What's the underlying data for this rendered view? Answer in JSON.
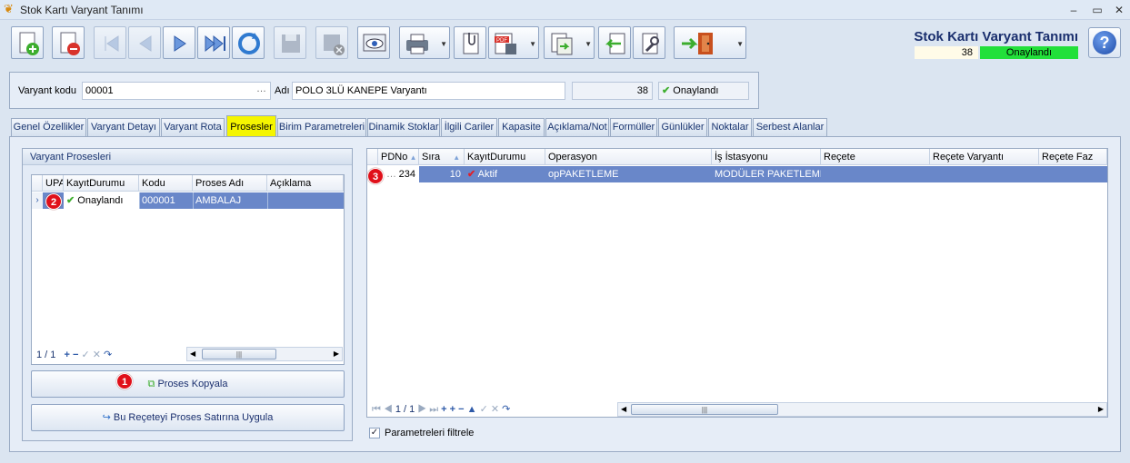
{
  "window": {
    "title": "Stok Kartı Varyant Tanımı",
    "minimize": "–",
    "restore": "▭",
    "close": "✕"
  },
  "header": {
    "title": "Stok Kartı Varyant Tanımı",
    "number": "38",
    "status": "Onaylandı",
    "status_color": "#22e03a"
  },
  "toolbar": {
    "buttons": [
      {
        "icon": "new-document-icon",
        "enabled": true
      },
      {
        "icon": "delete-document-icon",
        "enabled": true
      },
      {
        "icon": "first-record-icon",
        "enabled": false
      },
      {
        "icon": "previous-record-icon",
        "enabled": false
      },
      {
        "icon": "next-record-icon",
        "enabled": true
      },
      {
        "icon": "last-record-icon",
        "enabled": true
      },
      {
        "icon": "refresh-icon",
        "enabled": true
      },
      {
        "icon": "save-icon",
        "enabled": false
      },
      {
        "icon": "cancel-save-icon",
        "enabled": false
      },
      {
        "icon": "preview-icon",
        "enabled": true
      },
      {
        "icon": "print-icon",
        "enabled": true
      },
      {
        "icon": "attachment-icon",
        "enabled": true
      },
      {
        "icon": "pdf-export-icon",
        "enabled": true
      },
      {
        "icon": "export-icon",
        "enabled": true
      },
      {
        "icon": "import-icon",
        "enabled": true
      },
      {
        "icon": "settings-tool-icon",
        "enabled": true
      },
      {
        "icon": "exit-door-icon",
        "enabled": true
      }
    ]
  },
  "form": {
    "variant_code_label": "Varyant kodu",
    "variant_code": "00001",
    "name_label": "Adı",
    "name_value": "POLO 3LÜ KANEPE Varyantı",
    "number": "38",
    "status": "Onaylandı"
  },
  "tabs": [
    {
      "label": "Genel Özellikler"
    },
    {
      "label": "Varyant Detayı"
    },
    {
      "label": "Varyant Rota"
    },
    {
      "label": "Prosesler",
      "active": true
    },
    {
      "label": "Birim Parametreleri"
    },
    {
      "label": "Dinamik Stoklar"
    },
    {
      "label": "İlgili Cariler"
    },
    {
      "label": "Kapasite"
    },
    {
      "label": "Açıklama/Not"
    },
    {
      "label": "Formüller"
    },
    {
      "label": "Günlükler"
    },
    {
      "label": "Noktalar"
    },
    {
      "label": "Serbest Alanlar"
    }
  ],
  "left_panel": {
    "title": "Varyant Prosesleri",
    "columns": [
      "UPA",
      "KayıtDurumu",
      "Kodu",
      "Proses Adı",
      "Açıklama"
    ],
    "rows": [
      {
        "upa": "",
        "status": "Onaylandı",
        "code": "000001",
        "name": "AMBALAJ",
        "desc": ""
      }
    ],
    "pager": "1 / 1",
    "nav_icons": [
      "+",
      "−",
      "✓",
      "✕",
      "↷"
    ],
    "copy_button": "Proses Kopyala",
    "apply_button": "Bu Reçeteyi Proses Satırına Uygula"
  },
  "right_panel": {
    "columns": [
      "PDNo",
      "Sıra",
      "KayıtDurumu",
      "Operasyon",
      "İş İstasyonu",
      "Reçete",
      "Reçete Varyantı",
      "Reçete Faz"
    ],
    "rows": [
      {
        "pdno": "234",
        "sira": "10",
        "status": "Aktif",
        "operation": "opPAKETLEME",
        "station": "MODÜLER PAKETLEME",
        "recete": "",
        "variant": "",
        "faz": ""
      }
    ],
    "pager": "1 / 1",
    "filter_label": "Parametreleri filtrele",
    "filter_checked": true
  },
  "markers": [
    "1",
    "2",
    "3"
  ]
}
